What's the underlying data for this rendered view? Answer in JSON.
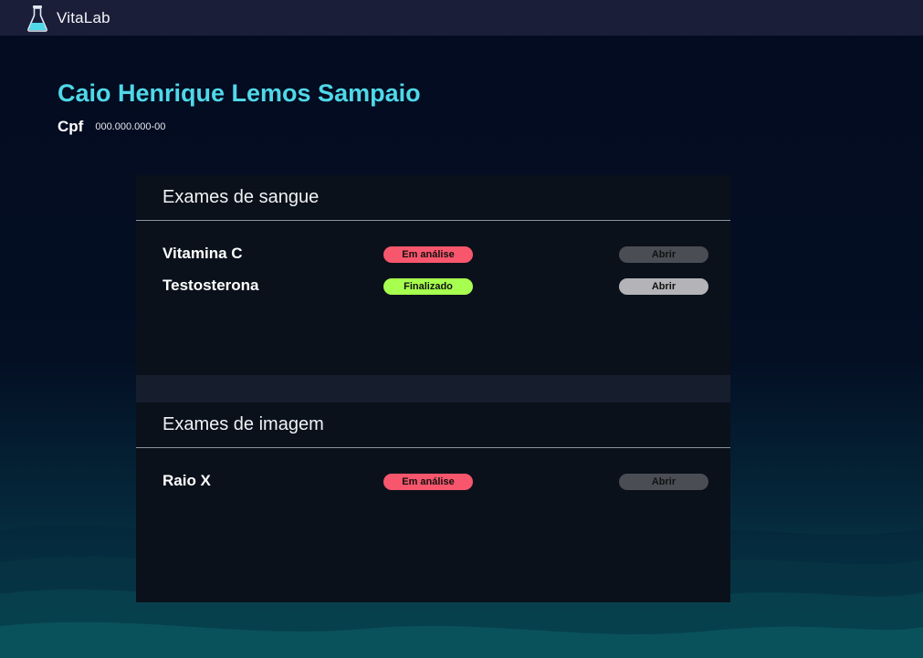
{
  "app": {
    "brand": "VitaLab",
    "logo_icon": "flask-icon"
  },
  "patient": {
    "name": "Caio Henrique Lemos Sampaio",
    "cpf_label": "Cpf",
    "cpf_value": "000.000.000-00"
  },
  "colors": {
    "accent": "#4fd8e8",
    "status_analysis": "#f7566c",
    "status_done": "#a7ff4f",
    "topbar": "#1b1e38"
  },
  "blood_exams": {
    "title": "Exames de sangue",
    "items": [
      {
        "name": "Vitamina C",
        "status": "Em análise",
        "button": "Abrir"
      },
      {
        "name": "Testosterona",
        "status": "Finalizado",
        "button": "Abrir"
      }
    ]
  },
  "image_exams": {
    "title": "Exames de imagem",
    "items": [
      {
        "name": "Raio X",
        "status": "Em análise",
        "button": "Abrir"
      }
    ]
  }
}
